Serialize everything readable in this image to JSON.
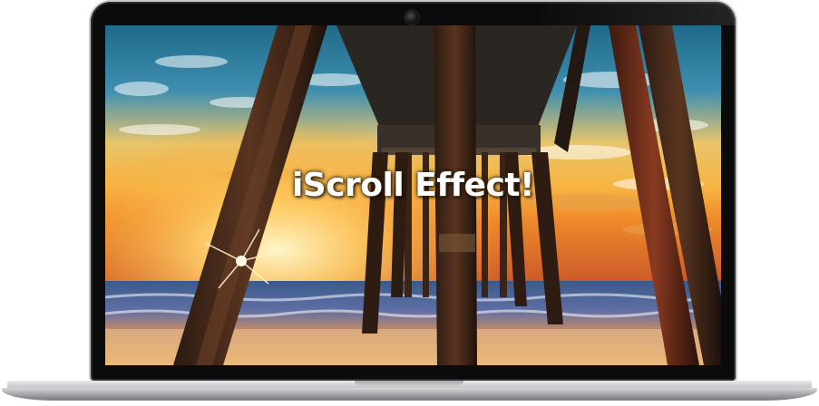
{
  "screen": {
    "headline": "iScroll Effect!"
  },
  "device": {
    "frame_color": "#0b0b0c",
    "base_color": "#c9c9cc"
  },
  "photo": {
    "subject": "pier-at-sunset-image"
  }
}
